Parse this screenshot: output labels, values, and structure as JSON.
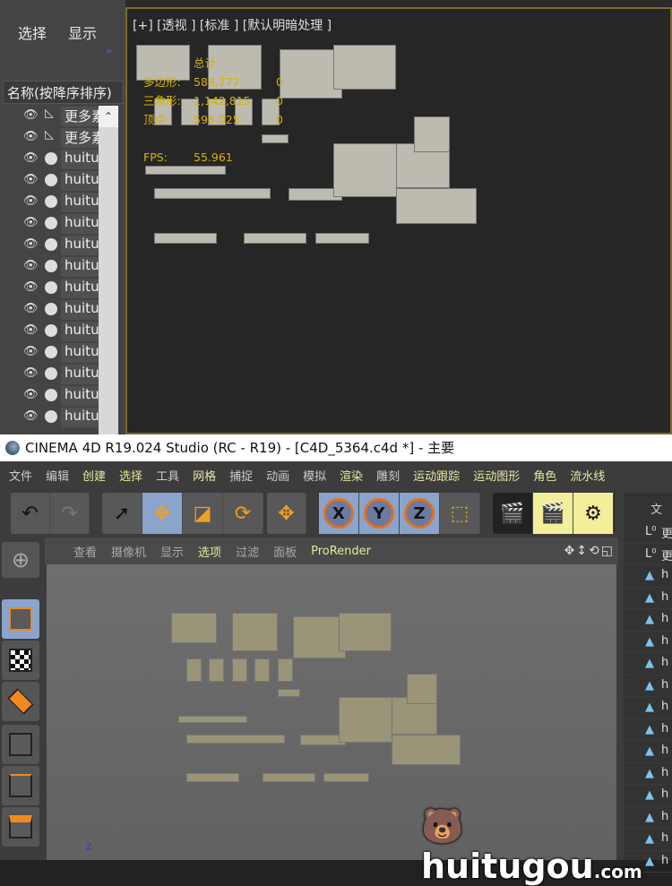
{
  "max": {
    "tabs": [
      "选择",
      "显示"
    ],
    "column_header": "名称(按降序排序)",
    "rows": [
      {
        "label": "更多素",
        "icon": "triangle"
      },
      {
        "label": "更多素",
        "icon": "triangle"
      },
      {
        "label": "huitu",
        "icon": "circle"
      },
      {
        "label": "huitu",
        "icon": "circle"
      },
      {
        "label": "huitu",
        "icon": "circle"
      },
      {
        "label": "huitu",
        "icon": "circle"
      },
      {
        "label": "huitu",
        "icon": "circle"
      },
      {
        "label": "huitu",
        "icon": "circle"
      },
      {
        "label": "huitu",
        "icon": "circle"
      },
      {
        "label": "huitu",
        "icon": "circle"
      },
      {
        "label": "huitu",
        "icon": "circle"
      },
      {
        "label": "huitu",
        "icon": "circle"
      },
      {
        "label": "huitu",
        "icon": "circle"
      },
      {
        "label": "huitu",
        "icon": "circle"
      },
      {
        "label": "huitu",
        "icon": "circle"
      }
    ],
    "viewport_label": "[+] [透视 ] [标准 ] [默认明暗处理 ]",
    "stats": {
      "header": "总计",
      "polys_label": "多边形:",
      "polys": "589,777",
      "polys_sel": "0",
      "tris_label": "三角形:",
      "tris": "1,142,815",
      "tris_sel": "0",
      "verts_label": "顶点:",
      "verts": "596,025",
      "verts_sel": "0",
      "fps_label": "FPS:",
      "fps": "55.961"
    }
  },
  "c4d": {
    "title": "CINEMA 4D R19.024 Studio (RC - R19) - [C4D_5364.c4d *] - 主要",
    "menu": [
      "文件",
      "编辑",
      "创建",
      "选择",
      "工具",
      "网格",
      "捕捉",
      "动画",
      "模拟",
      "渲染",
      "雕刻",
      "运动跟踪",
      "运动图形",
      "角色",
      "流水线"
    ],
    "axis": [
      "X",
      "Y",
      "Z"
    ],
    "view_menu": [
      "查看",
      "摄像机",
      "显示",
      "选项",
      "过滤",
      "面板",
      "ProRender"
    ],
    "panel_tab": "文",
    "obj_rows": [
      {
        "label": "更",
        "icon": "null"
      },
      {
        "label": "更",
        "icon": "null"
      },
      {
        "label": "h",
        "icon": "polygon"
      },
      {
        "label": "h",
        "icon": "polygon"
      },
      {
        "label": "h",
        "icon": "polygon"
      },
      {
        "label": "h",
        "icon": "polygon"
      },
      {
        "label": "h",
        "icon": "polygon"
      },
      {
        "label": "h",
        "icon": "polygon"
      },
      {
        "label": "h",
        "icon": "polygon"
      },
      {
        "label": "h",
        "icon": "polygon"
      },
      {
        "label": "h",
        "icon": "polygon"
      },
      {
        "label": "h",
        "icon": "polygon"
      },
      {
        "label": "h",
        "icon": "polygon"
      },
      {
        "label": "h",
        "icon": "polygon"
      },
      {
        "label": "h",
        "icon": "polygon"
      },
      {
        "label": "h",
        "icon": "polygon"
      }
    ],
    "axis_label": "Z"
  },
  "watermark": {
    "name": "huitugou",
    ".com": ".com"
  }
}
